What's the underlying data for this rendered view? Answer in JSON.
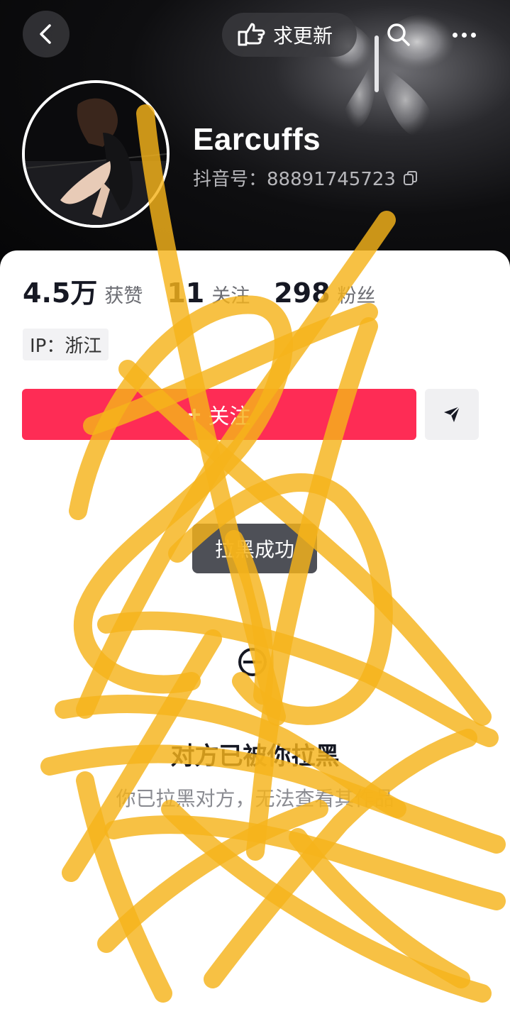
{
  "header": {
    "update_label": "求更新",
    "icons": [
      "back-arrow-icon",
      "hand-point-icon",
      "search-icon",
      "more-icon",
      "copy-icon"
    ]
  },
  "profile": {
    "nickname": "Earcuffs",
    "douyin_id": "抖音号：88891745723"
  },
  "stats": {
    "likes_value": "4.5万",
    "likes_label": "获赞",
    "following_value": "11",
    "following_label": "关注",
    "followers_value": "298",
    "followers_label": "粉丝"
  },
  "ip_tag": "IP：浙江",
  "actions": {
    "follow_label": "关注",
    "message_icon": "send-icon"
  },
  "toast": "拉黑成功",
  "blocked": {
    "title": "对方已被你拉黑",
    "subtitle": "你已拉黑对方，无法查看其作品"
  },
  "colors": {
    "accent": "#fe2c55",
    "scribble": "#f5b31b"
  }
}
